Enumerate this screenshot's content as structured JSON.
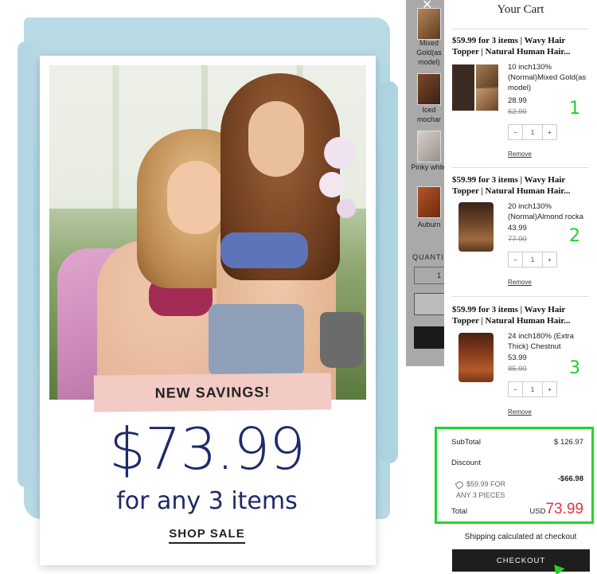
{
  "promo": {
    "banner": "NEW SAVINGS!",
    "price": "$73.99",
    "subtitle": "for any 3 items",
    "cta": "SHOP SALE"
  },
  "background_panel": {
    "swatches": [
      {
        "label": "Mixed Gold(as model)"
      },
      {
        "label": "Iced mochar"
      },
      {
        "label": "Pinky white"
      },
      {
        "label": "Auburn"
      }
    ],
    "quantity_label": "QUANTIT",
    "quantity_value": "1"
  },
  "cart": {
    "title": "Your Cart",
    "items": [
      {
        "title_line1": "$59.99 for 3 items | Wavy Hair",
        "title_line2": "Topper | Natural Human Hair...",
        "variant": "10 inch130% (Normal)Mixed Gold(as model)",
        "price": "28.99",
        "compare_price": "62.90",
        "qty": "1",
        "minus": "−",
        "plus": "+",
        "remove": "Remove",
        "annotation": "1"
      },
      {
        "title_line1": "$59.99 for 3 items | Wavy Hair",
        "title_line2": "Topper | Natural Human Hair...",
        "variant": "20 inch130% (Normal)Almond rocka",
        "price": "43.99",
        "compare_price": "77.90",
        "qty": "1",
        "minus": "−",
        "plus": "+",
        "remove": "Remove",
        "annotation": "2"
      },
      {
        "title_line1": "$59.99 for 3 items | Wavy Hair",
        "title_line2": "Topper | Natural Human Hair...",
        "variant": "24 inch180% (Extra Thick) Chestnut",
        "price": "53.99",
        "compare_price": "85.90",
        "qty": "1",
        "minus": "−",
        "plus": "+",
        "remove": "Remove",
        "annotation": "3"
      }
    ],
    "summary": {
      "subtotal_label": "SubTotal",
      "subtotal_value": "$ 126.97",
      "discount_label": "Discount",
      "coupon_line1": "$59.99 FOR",
      "coupon_line2": "ANY 3 PIECES",
      "discount_value": "-$66.98",
      "total_label": "Total",
      "total_currency": "USD",
      "total_value": "73.99"
    },
    "shipping_note": "Shipping calculated at checkout",
    "checkout_label": "CHECKOUT"
  },
  "colors": {
    "accent_green": "#22d42a",
    "total_red": "#e8323a",
    "promo_navy": "#1f2a6b"
  }
}
